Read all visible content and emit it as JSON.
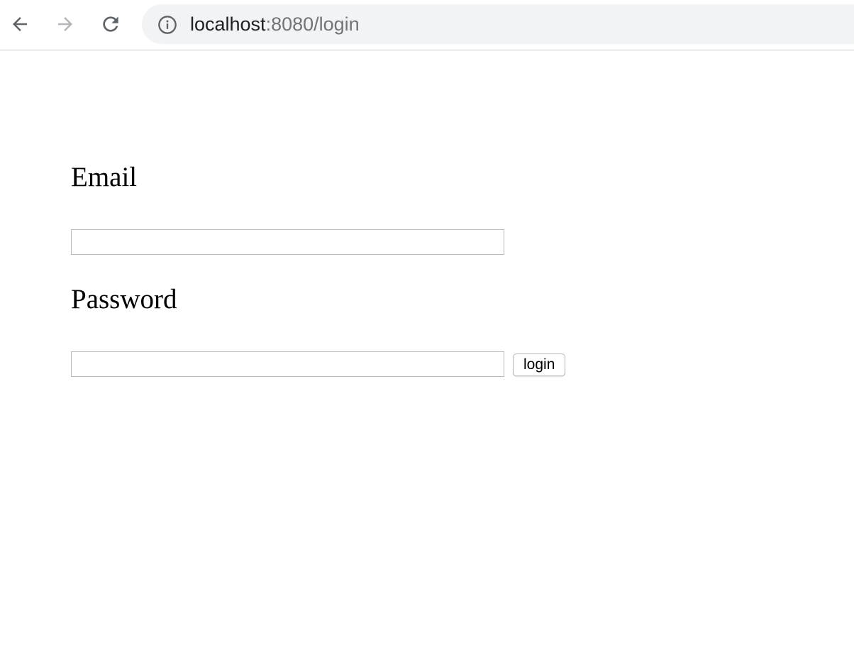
{
  "browser": {
    "url_host": "localhost",
    "url_rest": ":8080/login",
    "icons": {
      "back": "arrow-left-icon",
      "forward": "arrow-right-icon",
      "reload": "reload-icon",
      "site_info": "info-circle-icon"
    },
    "colors": {
      "icon_active": "#5f6368",
      "icon_disabled": "#b4b6b9",
      "omnibox_bg": "#f1f3f4"
    }
  },
  "form": {
    "email_label": "Email",
    "email_value": "",
    "password_label": "Password",
    "password_value": "",
    "submit_label": "login"
  }
}
